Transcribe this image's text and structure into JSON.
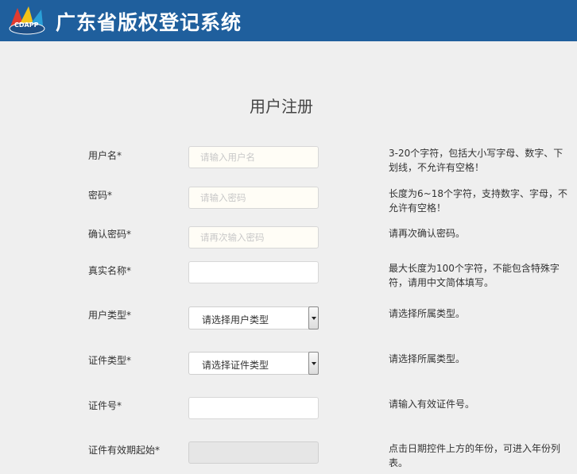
{
  "header": {
    "logo_text": "CDAPP",
    "title": "广东省版权登记系统"
  },
  "form": {
    "title": "用户注册",
    "fields": [
      {
        "label": "用户名*",
        "placeholder": "请输入用户名",
        "value": "",
        "hint": "3-20个字符，包括大小写字母、数字、下划线，不允许有空格！"
      },
      {
        "label": "密码*",
        "placeholder": "请输入密码",
        "value": "",
        "hint": "长度为6~18个字符，支持数字、字母，不允许有空格！"
      },
      {
        "label": "确认密码*",
        "placeholder": "请再次输入密码",
        "value": "",
        "hint": "请再次确认密码。"
      },
      {
        "label": "真实名称*",
        "placeholder": "",
        "value": "",
        "hint": "最大长度为100个字符，不能包含特殊字符，请用中文简体填写。"
      },
      {
        "label": "用户类型*",
        "selected": "请选择用户类型",
        "hint": "请选择所属类型。"
      },
      {
        "label": "证件类型*",
        "selected": "请选择证件类型",
        "hint": "请选择所属类型。"
      },
      {
        "label": "证件号*",
        "placeholder": "",
        "value": "",
        "hint": "请输入有效证件号。"
      },
      {
        "label": "证件有效期起始*",
        "placeholder": "",
        "value": "",
        "hint": "点击日期控件上方的年份，可进入年份列表。"
      }
    ]
  }
}
